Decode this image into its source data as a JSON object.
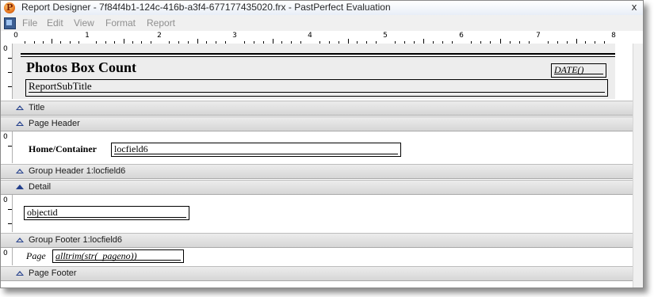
{
  "window": {
    "title": "Report Designer - 7f84f4b1-124c-416b-a3f4-677177435020.frx - PastPerfect Evaluation",
    "app_icon": "pastperfect-app-icon",
    "close_glyph": "x"
  },
  "menu": {
    "icon": "report-designer-menu-icon",
    "items": [
      "File",
      "Edit",
      "View",
      "Format",
      "Report"
    ]
  },
  "ruler": {
    "labels": [
      "0",
      "1",
      "2",
      "3",
      "4",
      "5",
      "6",
      "7",
      "8"
    ]
  },
  "vruler": {
    "zero": "0"
  },
  "title_band": {
    "title": "Photos Box Count",
    "date_field": "DATE()",
    "subtitle_field": "ReportSubTitle"
  },
  "bands": {
    "title": "Title",
    "page_header": "Page Header",
    "group_header": "Group Header 1:locfield6",
    "detail": "Detail",
    "group_footer": "Group Footer 1:locfield6",
    "page_footer": "Page Footer"
  },
  "group_header_band": {
    "label": "Home/Container",
    "field": "locfield6"
  },
  "detail_band": {
    "field": "objectid"
  },
  "page_footer_band": {
    "label": "Page",
    "field": "alltrim(str(_pageno))"
  },
  "colors": {
    "band_triangle": "#233f8c",
    "disabled_menu_text": "#8f8f8f"
  }
}
